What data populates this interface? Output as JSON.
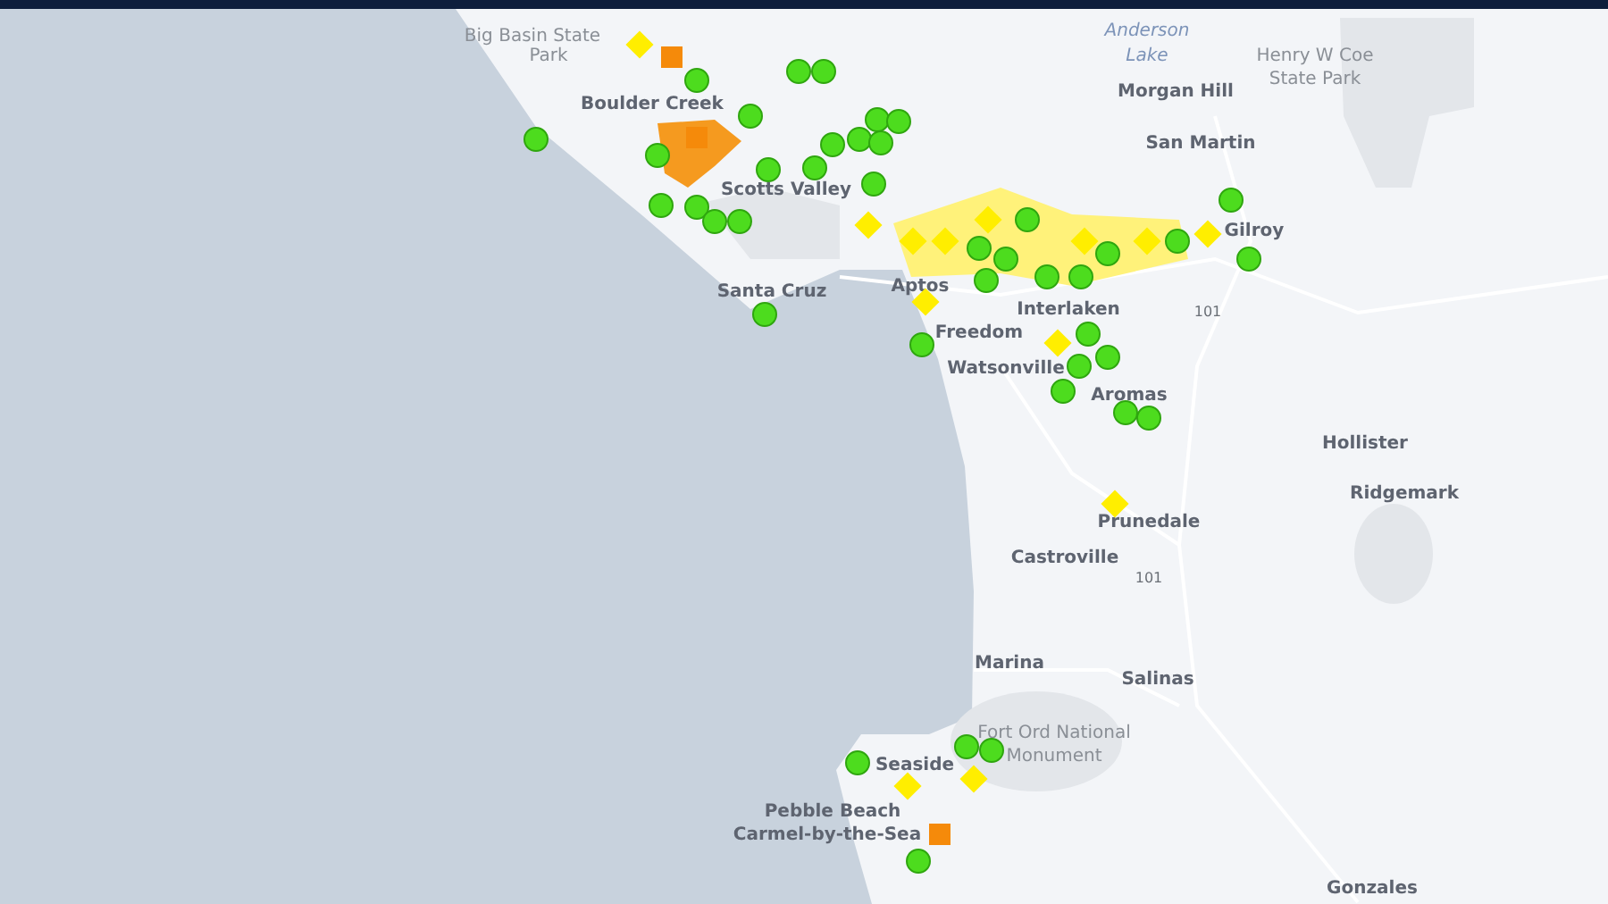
{
  "map": {
    "labels": [
      {
        "text": "Anderson",
        "kind": "water"
      },
      {
        "text": "Big Basin State",
        "kind": "park"
      },
      {
        "text": "Park",
        "kind": "park"
      },
      {
        "text": "Lake",
        "kind": "water"
      },
      {
        "text": "Henry W Coe",
        "kind": "park"
      },
      {
        "text": "State Park",
        "kind": "park"
      },
      {
        "text": "Morgan Hill",
        "kind": "city"
      },
      {
        "text": "Boulder Creek",
        "kind": "city"
      },
      {
        "text": "San Martin",
        "kind": "city"
      },
      {
        "text": "Scotts Valley",
        "kind": "city"
      },
      {
        "text": "Gilroy",
        "kind": "city"
      },
      {
        "text": "Aptos",
        "kind": "city"
      },
      {
        "text": "Santa Cruz",
        "kind": "city"
      },
      {
        "text": "Interlaken",
        "kind": "city"
      },
      {
        "text": "101",
        "kind": "highway"
      },
      {
        "text": "Freedom",
        "kind": "city"
      },
      {
        "text": "Watsonville",
        "kind": "city"
      },
      {
        "text": "Aromas",
        "kind": "city"
      },
      {
        "text": "Hollister",
        "kind": "city"
      },
      {
        "text": "Ridgemark",
        "kind": "city"
      },
      {
        "text": "Prunedale",
        "kind": "city"
      },
      {
        "text": "Castroville",
        "kind": "city"
      },
      {
        "text": "101",
        "kind": "highway"
      },
      {
        "text": "Marina",
        "kind": "city"
      },
      {
        "text": "Salinas",
        "kind": "city"
      },
      {
        "text": "Fort Ord National",
        "kind": "park"
      },
      {
        "text": "Monument",
        "kind": "park"
      },
      {
        "text": "Seaside",
        "kind": "city"
      },
      {
        "text": "Pebble Beach",
        "kind": "city"
      },
      {
        "text": "Carmel-by-the-Sea",
        "kind": "city"
      },
      {
        "text": "Gonzales",
        "kind": "city"
      }
    ]
  }
}
